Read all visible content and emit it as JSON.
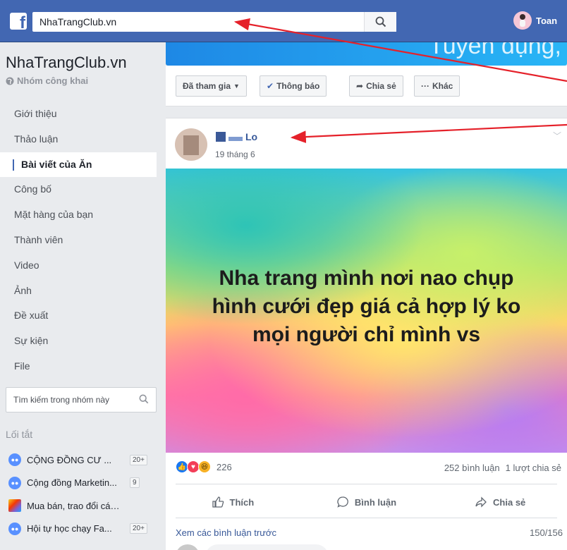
{
  "topbar": {
    "search_value": "NhaTrangClub.vn",
    "user_name": "Toan",
    "brand_color": "#4267b2"
  },
  "group": {
    "name": "NhaTrangClub.vn",
    "privacy": "Nhóm công khai"
  },
  "nav": {
    "items": [
      {
        "label": "Giới thiệu"
      },
      {
        "label": "Thảo luận"
      },
      {
        "label": "Bài viết của Ăn"
      },
      {
        "label": "Công bố"
      },
      {
        "label": "Mặt hàng của bạn"
      },
      {
        "label": "Thành viên"
      },
      {
        "label": "Video"
      },
      {
        "label": "Ảnh"
      },
      {
        "label": "Đề xuất"
      },
      {
        "label": "Sự kiện"
      },
      {
        "label": "File"
      }
    ],
    "active_index": 2
  },
  "group_search": {
    "placeholder": "Tìm kiếm trong nhóm này"
  },
  "shortcuts": {
    "title": "Lối tắt",
    "items": [
      {
        "label": "CỘNG ĐỒNG CƯ ...",
        "badge": "20+",
        "icon": "group-icon"
      },
      {
        "label": "Cộng đồng Marketin...",
        "badge": "9",
        "icon": "group-icon"
      },
      {
        "label": "Mua bán, trao đổi các t...",
        "badge": "",
        "icon": "rainbow-group-icon"
      },
      {
        "label": "Hội tự học chạy Fa...",
        "badge": "20+",
        "icon": "group-icon"
      }
    ]
  },
  "cover": {
    "text": "Tuyển dụng,"
  },
  "actions": {
    "joined": "Đã tham gia",
    "notify": "Thông báo",
    "share": "Chia sẻ",
    "more": "Khác"
  },
  "post": {
    "author": "Lo",
    "date": "19 tháng 6",
    "text_line1": "Nha trang mình nơi nao chụp",
    "text_line2": "hình cưới đẹp giá cả hợp lý ko",
    "text_line3": "mọi người chỉ mình vs",
    "reaction_count": "226",
    "comments": "252 bình luận",
    "shares": "1 lượt chia sẻ",
    "like_label": "Thích",
    "comment_label": "Bình luận",
    "share_label": "Chia sẻ",
    "view_previous": "Xem các bình luận trước",
    "comment_progress": "150/156"
  }
}
